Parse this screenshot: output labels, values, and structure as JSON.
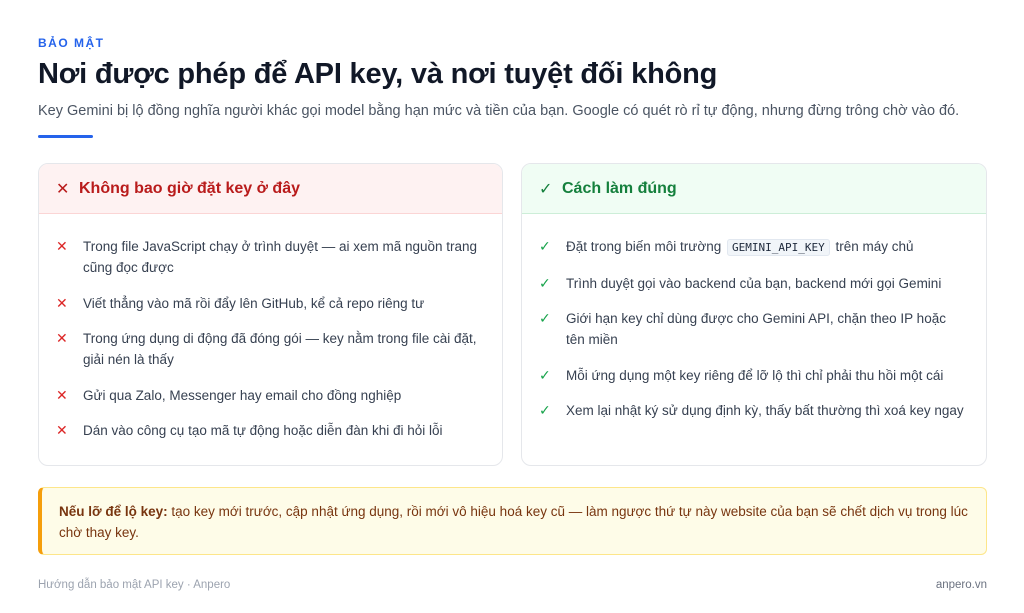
{
  "header": {
    "eyebrow": "BẢO MẬT",
    "title": "Nơi được phép để API key, và nơi tuyệt đối không",
    "subtitle": "Key Gemini bị lộ đồng nghĩa người khác gọi model bằng hạn mức và tiền của bạn. Google có quét rò rỉ tự động, nhưng đừng trông chờ vào đó."
  },
  "bad_card": {
    "title": "Không bao giờ đặt key ở đây",
    "icon": "x-icon",
    "items": [
      "Trong file JavaScript chạy ở trình duyệt — ai xem mã nguồn trang cũng đọc được",
      "Viết thẳng vào mã rồi đẩy lên GitHub, kể cả repo riêng tư",
      "Trong ứng dụng di động đã đóng gói — key nằm trong file cài đặt, giải nén là thấy",
      "Gửi qua Zalo, Messenger hay email cho đồng nghiệp",
      "Dán vào công cụ tạo mã tự động hoặc diễn đàn khi đi hỏi lỗi"
    ]
  },
  "good_card": {
    "title": "Cách làm đúng",
    "icon": "check-icon",
    "item0": {
      "before": "Đặt trong biến môi trường",
      "code": "GEMINI_API_KEY",
      "after": "trên máy chủ"
    },
    "items": [
      "Trình duyệt gọi vào backend của bạn, backend mới gọi Gemini",
      "Giới hạn key chỉ dùng được cho Gemini API, chặn theo IP hoặc tên miền",
      "Mỗi ứng dụng một key riêng để lỡ lộ thì chỉ phải thu hồi một cái",
      "Xem lại nhật ký sử dụng định kỳ, thấy bất thường thì xoá key ngay"
    ]
  },
  "note": {
    "lead": "Nếu lỡ để lộ key:",
    "text": "tạo key mới trước, cập nhật ứng dụng, rồi mới vô hiệu hoá key cũ — làm ngược thứ tự này website của bạn sẽ chết dịch vụ trong lúc chờ thay key."
  },
  "footer": {
    "left": "Hướng dẫn bảo mật API key · Anpero",
    "right": "anpero.vn"
  },
  "colors": {
    "accent": "#2563eb",
    "danger": "#dc2626",
    "success": "#16a34a",
    "warning": "#f59e0b"
  }
}
